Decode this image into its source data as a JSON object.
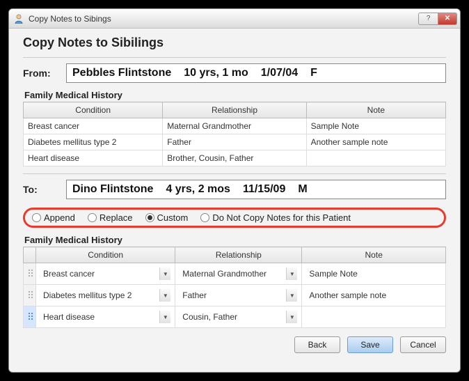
{
  "window": {
    "title": "Copy Notes to Sibings"
  },
  "page": {
    "title": "Copy Notes to Sibilings"
  },
  "from": {
    "label": "From:",
    "name": "Pebbles Flintstone",
    "age": "10 yrs, 1 mo",
    "dob": "1/07/04",
    "sex": "F"
  },
  "section_from_title": "Family Medical History",
  "from_table": {
    "headers": {
      "condition": "Condition",
      "relationship": "Relationship",
      "note": "Note"
    },
    "rows": [
      {
        "condition": "Breast cancer",
        "relationship": "Maternal Grandmother",
        "note": "Sample Note"
      },
      {
        "condition": "Diabetes mellitus type 2",
        "relationship": "Father",
        "note": "Another sample note"
      },
      {
        "condition": "Heart disease",
        "relationship": "Brother, Cousin, Father",
        "note": ""
      }
    ]
  },
  "to": {
    "label": "To:",
    "name": "Dino Flintstone",
    "age": "4 yrs, 2 mos",
    "dob": "11/15/09",
    "sex": "M"
  },
  "radios": {
    "append": "Append",
    "replace": "Replace",
    "custom": "Custom",
    "donot": "Do Not Copy Notes for this Patient",
    "selected": "custom"
  },
  "section_to_title": "Family Medical History",
  "to_table": {
    "headers": {
      "condition": "Condition",
      "relationship": "Relationship",
      "note": "Note"
    },
    "rows": [
      {
        "condition": "Breast cancer",
        "relationship": "Maternal Grandmother",
        "note": "Sample Note",
        "selected": false
      },
      {
        "condition": "Diabetes mellitus type 2",
        "relationship": "Father",
        "note": "Another sample note",
        "selected": false
      },
      {
        "condition": "Heart disease",
        "relationship": "Cousin, Father",
        "note": "",
        "selected": true
      }
    ]
  },
  "buttons": {
    "back": "Back",
    "save": "Save",
    "cancel": "Cancel"
  }
}
